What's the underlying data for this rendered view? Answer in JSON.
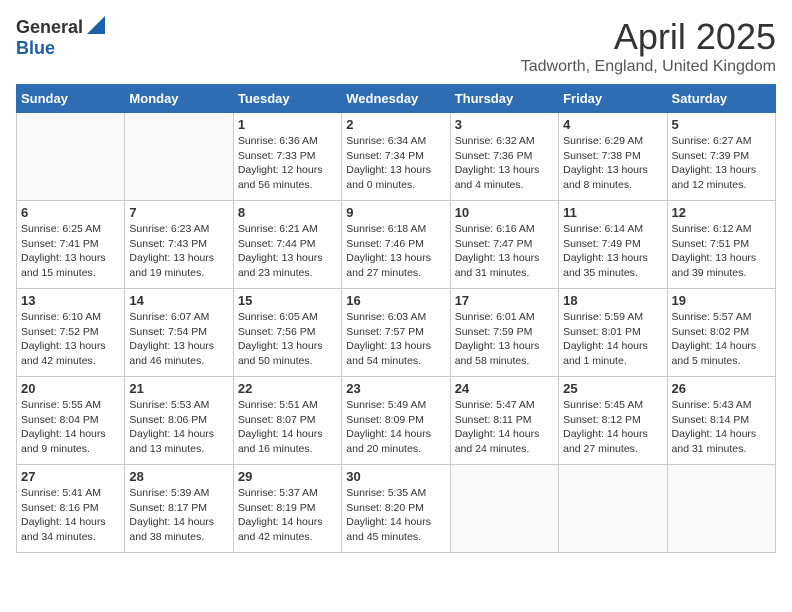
{
  "logo": {
    "general": "General",
    "blue": "Blue"
  },
  "title": "April 2025",
  "subtitle": "Tadworth, England, United Kingdom",
  "days_header": [
    "Sunday",
    "Monday",
    "Tuesday",
    "Wednesday",
    "Thursday",
    "Friday",
    "Saturday"
  ],
  "weeks": [
    [
      {
        "day": "",
        "info": ""
      },
      {
        "day": "",
        "info": ""
      },
      {
        "day": "1",
        "info": "Sunrise: 6:36 AM\nSunset: 7:33 PM\nDaylight: 12 hours\nand 56 minutes."
      },
      {
        "day": "2",
        "info": "Sunrise: 6:34 AM\nSunset: 7:34 PM\nDaylight: 13 hours\nand 0 minutes."
      },
      {
        "day": "3",
        "info": "Sunrise: 6:32 AM\nSunset: 7:36 PM\nDaylight: 13 hours\nand 4 minutes."
      },
      {
        "day": "4",
        "info": "Sunrise: 6:29 AM\nSunset: 7:38 PM\nDaylight: 13 hours\nand 8 minutes."
      },
      {
        "day": "5",
        "info": "Sunrise: 6:27 AM\nSunset: 7:39 PM\nDaylight: 13 hours\nand 12 minutes."
      }
    ],
    [
      {
        "day": "6",
        "info": "Sunrise: 6:25 AM\nSunset: 7:41 PM\nDaylight: 13 hours\nand 15 minutes."
      },
      {
        "day": "7",
        "info": "Sunrise: 6:23 AM\nSunset: 7:43 PM\nDaylight: 13 hours\nand 19 minutes."
      },
      {
        "day": "8",
        "info": "Sunrise: 6:21 AM\nSunset: 7:44 PM\nDaylight: 13 hours\nand 23 minutes."
      },
      {
        "day": "9",
        "info": "Sunrise: 6:18 AM\nSunset: 7:46 PM\nDaylight: 13 hours\nand 27 minutes."
      },
      {
        "day": "10",
        "info": "Sunrise: 6:16 AM\nSunset: 7:47 PM\nDaylight: 13 hours\nand 31 minutes."
      },
      {
        "day": "11",
        "info": "Sunrise: 6:14 AM\nSunset: 7:49 PM\nDaylight: 13 hours\nand 35 minutes."
      },
      {
        "day": "12",
        "info": "Sunrise: 6:12 AM\nSunset: 7:51 PM\nDaylight: 13 hours\nand 39 minutes."
      }
    ],
    [
      {
        "day": "13",
        "info": "Sunrise: 6:10 AM\nSunset: 7:52 PM\nDaylight: 13 hours\nand 42 minutes."
      },
      {
        "day": "14",
        "info": "Sunrise: 6:07 AM\nSunset: 7:54 PM\nDaylight: 13 hours\nand 46 minutes."
      },
      {
        "day": "15",
        "info": "Sunrise: 6:05 AM\nSunset: 7:56 PM\nDaylight: 13 hours\nand 50 minutes."
      },
      {
        "day": "16",
        "info": "Sunrise: 6:03 AM\nSunset: 7:57 PM\nDaylight: 13 hours\nand 54 minutes."
      },
      {
        "day": "17",
        "info": "Sunrise: 6:01 AM\nSunset: 7:59 PM\nDaylight: 13 hours\nand 58 minutes."
      },
      {
        "day": "18",
        "info": "Sunrise: 5:59 AM\nSunset: 8:01 PM\nDaylight: 14 hours\nand 1 minute."
      },
      {
        "day": "19",
        "info": "Sunrise: 5:57 AM\nSunset: 8:02 PM\nDaylight: 14 hours\nand 5 minutes."
      }
    ],
    [
      {
        "day": "20",
        "info": "Sunrise: 5:55 AM\nSunset: 8:04 PM\nDaylight: 14 hours\nand 9 minutes."
      },
      {
        "day": "21",
        "info": "Sunrise: 5:53 AM\nSunset: 8:06 PM\nDaylight: 14 hours\nand 13 minutes."
      },
      {
        "day": "22",
        "info": "Sunrise: 5:51 AM\nSunset: 8:07 PM\nDaylight: 14 hours\nand 16 minutes."
      },
      {
        "day": "23",
        "info": "Sunrise: 5:49 AM\nSunset: 8:09 PM\nDaylight: 14 hours\nand 20 minutes."
      },
      {
        "day": "24",
        "info": "Sunrise: 5:47 AM\nSunset: 8:11 PM\nDaylight: 14 hours\nand 24 minutes."
      },
      {
        "day": "25",
        "info": "Sunrise: 5:45 AM\nSunset: 8:12 PM\nDaylight: 14 hours\nand 27 minutes."
      },
      {
        "day": "26",
        "info": "Sunrise: 5:43 AM\nSunset: 8:14 PM\nDaylight: 14 hours\nand 31 minutes."
      }
    ],
    [
      {
        "day": "27",
        "info": "Sunrise: 5:41 AM\nSunset: 8:16 PM\nDaylight: 14 hours\nand 34 minutes."
      },
      {
        "day": "28",
        "info": "Sunrise: 5:39 AM\nSunset: 8:17 PM\nDaylight: 14 hours\nand 38 minutes."
      },
      {
        "day": "29",
        "info": "Sunrise: 5:37 AM\nSunset: 8:19 PM\nDaylight: 14 hours\nand 42 minutes."
      },
      {
        "day": "30",
        "info": "Sunrise: 5:35 AM\nSunset: 8:20 PM\nDaylight: 14 hours\nand 45 minutes."
      },
      {
        "day": "",
        "info": ""
      },
      {
        "day": "",
        "info": ""
      },
      {
        "day": "",
        "info": ""
      }
    ]
  ]
}
